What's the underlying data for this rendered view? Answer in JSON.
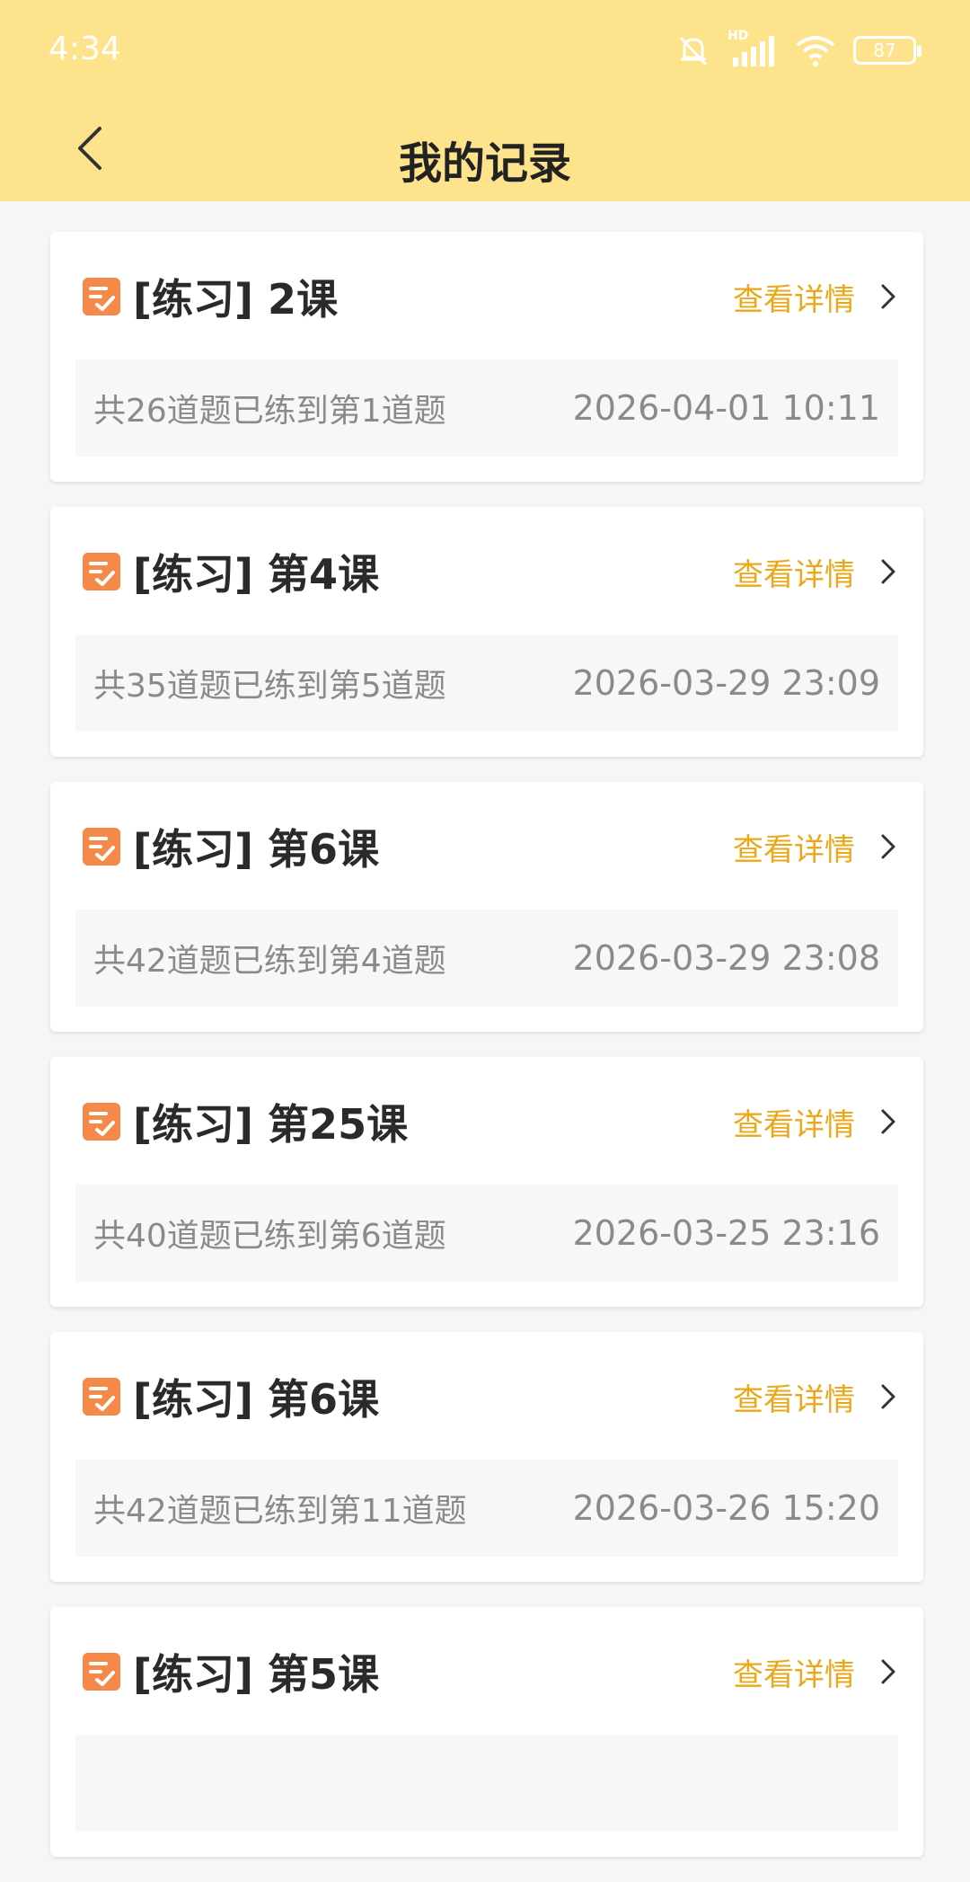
{
  "status_bar": {
    "time": "4:34",
    "network_label": "HD",
    "battery": "87"
  },
  "header": {
    "title": "我的记录"
  },
  "colors": {
    "header_bg": "#fde48c",
    "accent": "#eaa81a",
    "icon_orange": "#f5894a"
  },
  "records": [
    {
      "title": "[练习] 2课",
      "detail_label": "查看详情",
      "progress": "共26道题已练到第1道题",
      "time": "2026-04-01 10:11"
    },
    {
      "title": "[练习] 第4课",
      "detail_label": "查看详情",
      "progress": "共35道题已练到第5道题",
      "time": "2026-03-29 23:09"
    },
    {
      "title": "[练习] 第6课",
      "detail_label": "查看详情",
      "progress": "共42道题已练到第4道题",
      "time": "2026-03-29 23:08"
    },
    {
      "title": "[练习] 第25课",
      "detail_label": "查看详情",
      "progress": "共40道题已练到第6道题",
      "time": "2026-03-25 23:16"
    },
    {
      "title": "[练习] 第6课",
      "detail_label": "查看详情",
      "progress": "共42道题已练到第11道题",
      "time": "2026-03-26 15:20"
    },
    {
      "title": "[练习] 第5课",
      "detail_label": "查看详情",
      "progress": "",
      "time": ""
    }
  ]
}
